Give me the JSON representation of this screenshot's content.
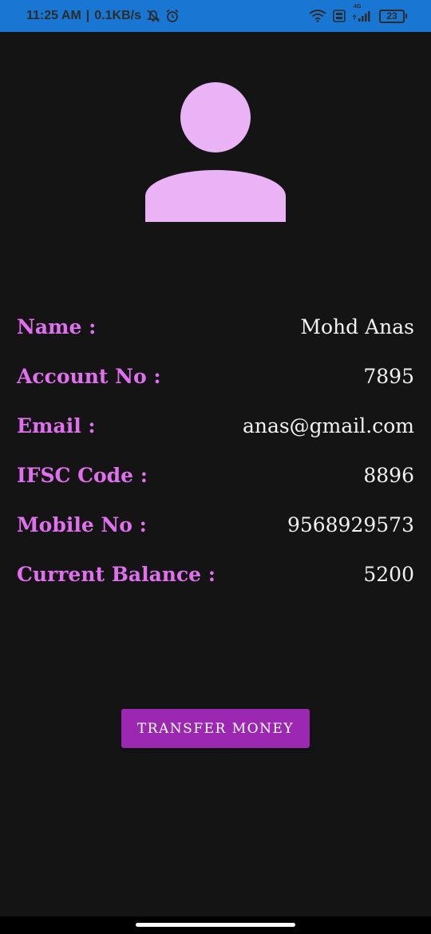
{
  "status_bar": {
    "time": "11:25 AM",
    "separator": "|",
    "speed": "0.1KB/s",
    "battery": "23",
    "signal_label": "4G",
    "icons": [
      "mute-icon",
      "alarm-icon",
      "wifi-icon",
      "volte-icon",
      "cell-signal-icon",
      "battery-icon"
    ]
  },
  "profile": {
    "avatar_icon": "person-icon",
    "avatar_color": "#e9b3f6"
  },
  "details": [
    {
      "label": "Name :",
      "value": "Mohd Anas"
    },
    {
      "label": "Account No :",
      "value": "7895"
    },
    {
      "label": "Email :",
      "value": "anas@gmail.com"
    },
    {
      "label": "IFSC Code :",
      "value": "8896"
    },
    {
      "label": "Mobile No :",
      "value": "9568929573"
    },
    {
      "label": "Current Balance :",
      "value": "5200"
    }
  ],
  "actions": {
    "transfer_label": "TRANSFER MONEY"
  },
  "colors": {
    "status_bar": "#1976d2",
    "background": "#141414",
    "label": "#e070ee",
    "value": "#f2f2f2",
    "button": "#9c27b0"
  }
}
